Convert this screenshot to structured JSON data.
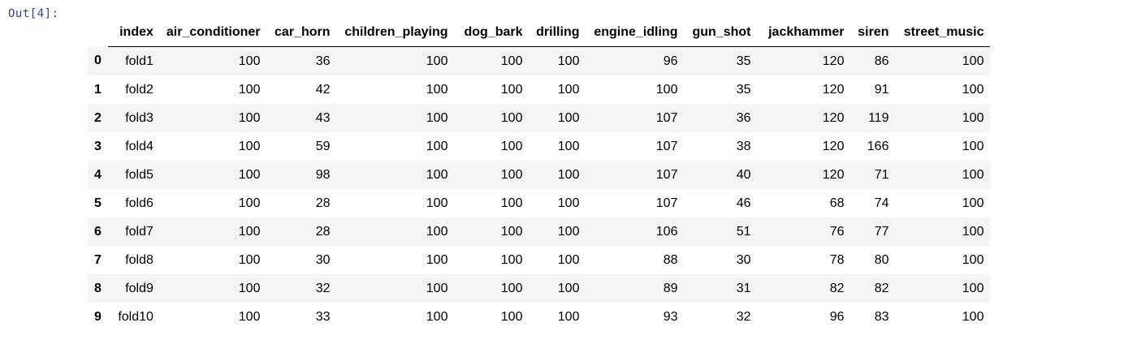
{
  "cell": {
    "prompt": "Out[4]:"
  },
  "table": {
    "columns": [
      "index",
      "air_conditioner",
      "car_horn",
      "children_playing",
      "dog_bark",
      "drilling",
      "engine_idling",
      "gun_shot",
      "jackhammer",
      "siren",
      "street_music"
    ],
    "rows": [
      {
        "row_index": "0",
        "cells": [
          "fold1",
          "100",
          "36",
          "100",
          "100",
          "100",
          "96",
          "35",
          "120",
          "86",
          "100"
        ]
      },
      {
        "row_index": "1",
        "cells": [
          "fold2",
          "100",
          "42",
          "100",
          "100",
          "100",
          "100",
          "35",
          "120",
          "91",
          "100"
        ]
      },
      {
        "row_index": "2",
        "cells": [
          "fold3",
          "100",
          "43",
          "100",
          "100",
          "100",
          "107",
          "36",
          "120",
          "119",
          "100"
        ]
      },
      {
        "row_index": "3",
        "cells": [
          "fold4",
          "100",
          "59",
          "100",
          "100",
          "100",
          "107",
          "38",
          "120",
          "166",
          "100"
        ]
      },
      {
        "row_index": "4",
        "cells": [
          "fold5",
          "100",
          "98",
          "100",
          "100",
          "100",
          "107",
          "40",
          "120",
          "71",
          "100"
        ]
      },
      {
        "row_index": "5",
        "cells": [
          "fold6",
          "100",
          "28",
          "100",
          "100",
          "100",
          "107",
          "46",
          "68",
          "74",
          "100"
        ]
      },
      {
        "row_index": "6",
        "cells": [
          "fold7",
          "100",
          "28",
          "100",
          "100",
          "100",
          "106",
          "51",
          "76",
          "77",
          "100"
        ]
      },
      {
        "row_index": "7",
        "cells": [
          "fold8",
          "100",
          "30",
          "100",
          "100",
          "100",
          "88",
          "30",
          "78",
          "80",
          "100"
        ]
      },
      {
        "row_index": "8",
        "cells": [
          "fold9",
          "100",
          "32",
          "100",
          "100",
          "100",
          "89",
          "31",
          "82",
          "82",
          "100"
        ]
      },
      {
        "row_index": "9",
        "cells": [
          "fold10",
          "100",
          "33",
          "100",
          "100",
          "100",
          "93",
          "32",
          "96",
          "83",
          "100"
        ]
      }
    ]
  }
}
